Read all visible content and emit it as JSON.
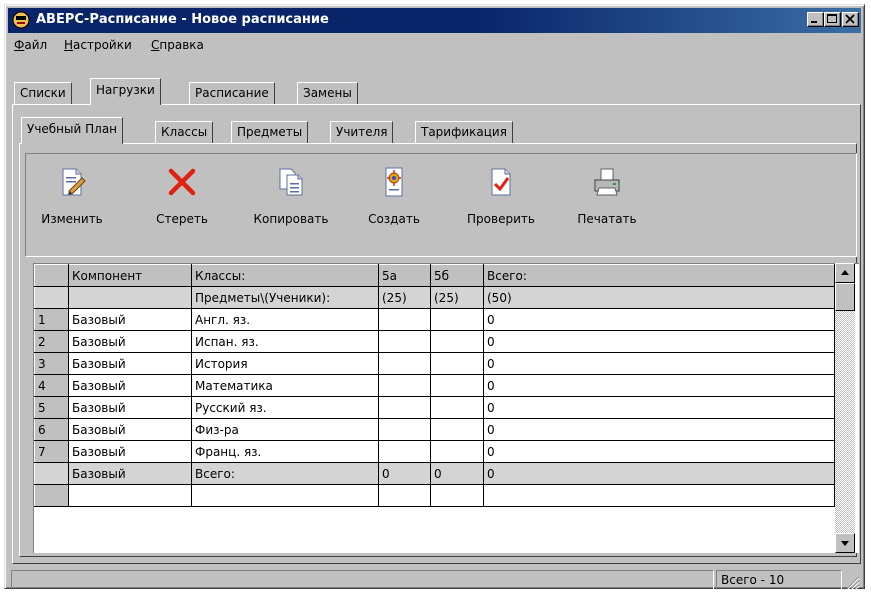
{
  "window": {
    "title": "АВЕРС-Расписание - Новое расписание"
  },
  "menu": {
    "items": [
      "Файл",
      "Настройки",
      "Справка"
    ]
  },
  "tabs": [
    "Списки",
    "Нагрузки",
    "Расписание",
    "Замены"
  ],
  "active_tab": "Нагрузки",
  "subtabs": [
    "Учебный План",
    "Классы",
    "Предметы",
    "Учителя",
    "Тарификация"
  ],
  "active_subtab": "Учебный План",
  "toolbar": {
    "edit": "Изменить",
    "delete": "Стереть",
    "copy": "Копировать",
    "create": "Создать",
    "check": "Проверить",
    "print": "Печатать"
  },
  "grid": {
    "header": [
      "",
      "Компонент",
      "Классы:",
      "5а",
      "5б",
      "Всего:"
    ],
    "subheader": [
      "",
      "",
      "Предметы\\(Ученики):",
      "(25)",
      "(25)",
      "(50)"
    ],
    "rows": [
      [
        "1",
        "Базовый",
        "Англ. яз.",
        "",
        "",
        "0"
      ],
      [
        "2",
        "Базовый",
        "Испан. яз.",
        "",
        "",
        "0"
      ],
      [
        "3",
        "Базовый",
        "История",
        "",
        "",
        "0"
      ],
      [
        "4",
        "Базовый",
        "Математика",
        "",
        "",
        "0"
      ],
      [
        "5",
        "Базовый",
        "Русский яз.",
        "",
        "",
        "0"
      ],
      [
        "6",
        "Базовый",
        "Физ-ра",
        "",
        "",
        "0"
      ],
      [
        "7",
        "Базовый",
        "Франц. яз.",
        "",
        "",
        "0"
      ]
    ],
    "total_row": [
      "",
      "Базовый",
      "Всего:",
      "0",
      "0",
      "0"
    ]
  },
  "status": {
    "total": "Всего - 10"
  }
}
